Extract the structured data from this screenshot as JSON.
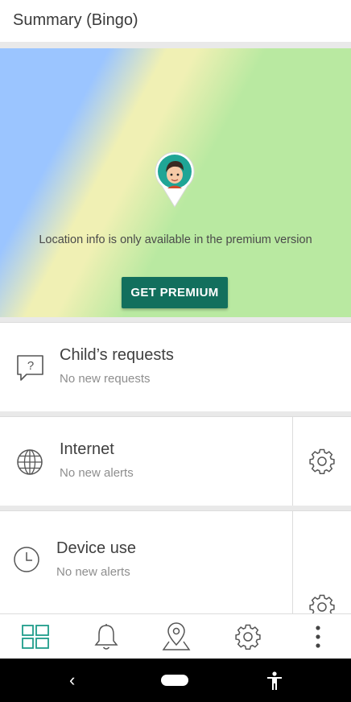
{
  "header": {
    "title": "Summary (Bingo)"
  },
  "map": {
    "location_text": "Location info is only available in the premium version",
    "premium_button": "GET PREMIUM"
  },
  "cards": {
    "requests": {
      "title": "Child’s requests",
      "subtitle": "No new requests",
      "icon": "chat-question-icon"
    },
    "internet": {
      "title": "Internet",
      "subtitle": "No new alerts",
      "icon": "globe-icon"
    },
    "device_use": {
      "title": "Device use",
      "subtitle": "No new alerts",
      "icon": "clock-icon"
    }
  },
  "bottom_nav": {
    "items": [
      "dashboard-icon",
      "bell-icon",
      "map-pin-icon",
      "gear-icon",
      "more-vertical-icon"
    ],
    "active": "dashboard-icon"
  },
  "colors": {
    "accent": "#1f9c8a",
    "premium_button": "#126f5d",
    "map_blue": "#9bc5ff",
    "map_yellow": "#f0f0b4",
    "map_green": "#b9e9a1"
  }
}
